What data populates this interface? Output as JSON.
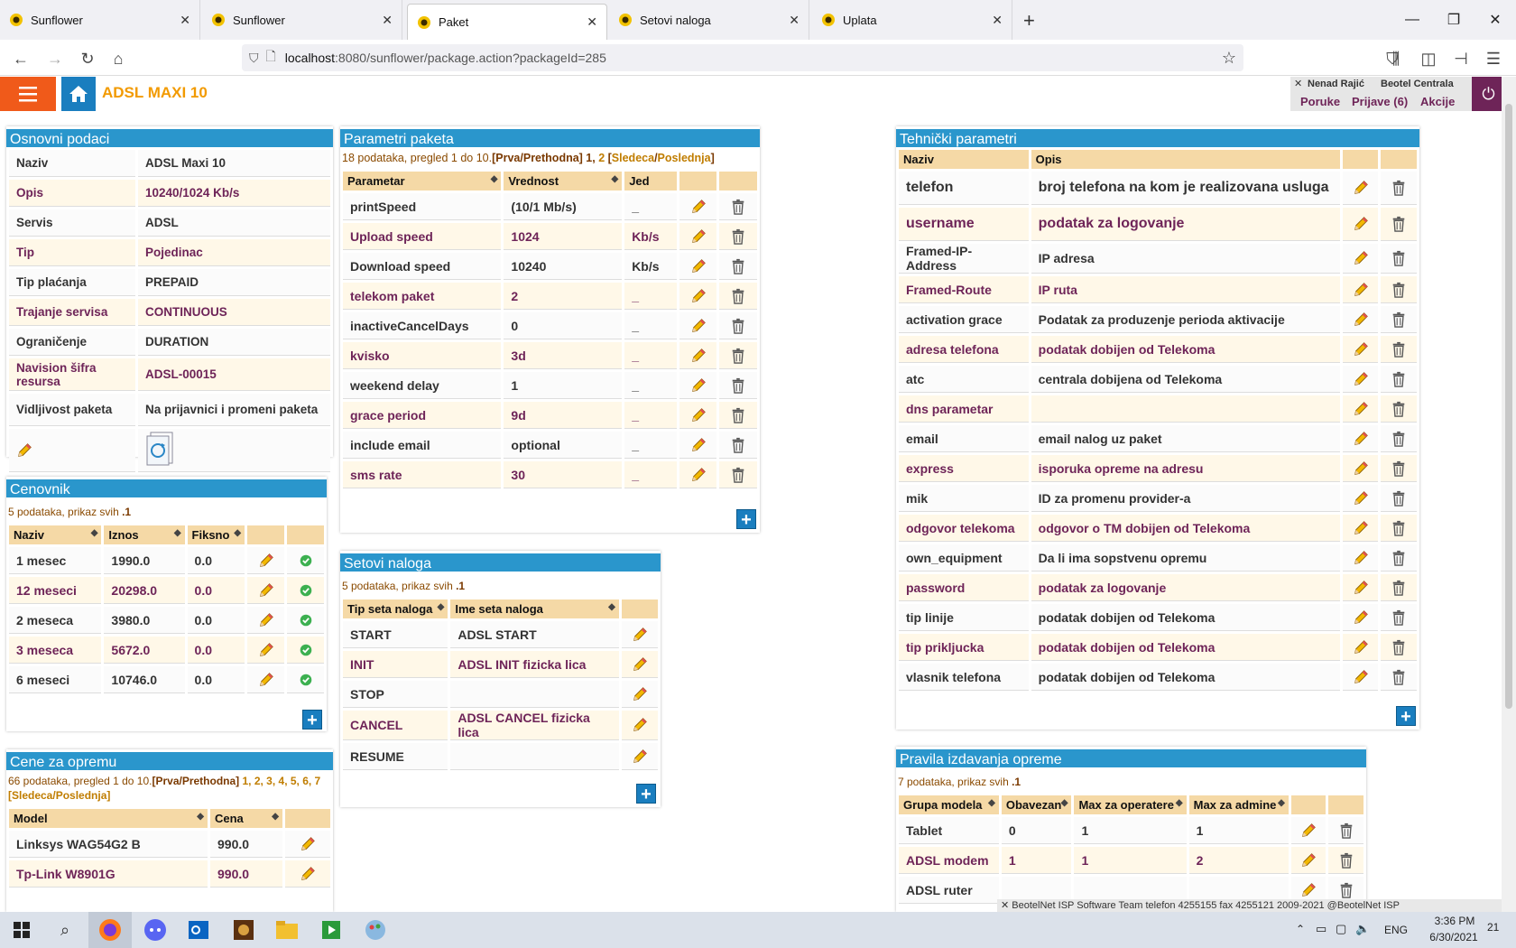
{
  "browser": {
    "tabs": [
      {
        "title": "Sunflower"
      },
      {
        "title": "Sunflower"
      },
      {
        "title": "Paket"
      },
      {
        "title": "Setovi naloga"
      },
      {
        "title": "Uplata"
      }
    ],
    "new_tab": "+",
    "url_host": "localhost",
    "url_rest": ":8080/sunflower/package.action?packageId=285"
  },
  "app": {
    "title": "ADSL MAXI 10",
    "user": "Nenad Rajić",
    "location": "Beotel Centrala",
    "nav": {
      "poruke": "Poruke",
      "prijave": "Prijave (6)",
      "akcije": "Akcije"
    },
    "close": "✕"
  },
  "osnovni": {
    "title": "Osnovni podaci",
    "rows": [
      {
        "label": "Naziv",
        "value": "ADSL Maxi 10"
      },
      {
        "label": "Opis",
        "value": "10240/1024 Kb/s"
      },
      {
        "label": "Servis",
        "value": "ADSL"
      },
      {
        "label": "Tip",
        "value": "Pojedinac"
      },
      {
        "label": "Tip plaćanja",
        "value": "PREPAID"
      },
      {
        "label": "Trajanje servisa",
        "value": "CONTINUOUS"
      },
      {
        "label": "Ograničenje",
        "value": "DURATION"
      },
      {
        "label": "Navision šifra resursa",
        "value": "ADSL-00015"
      },
      {
        "label": "Vidljivost paketa",
        "value": "Na prijavnici i promeni paketa"
      }
    ]
  },
  "parametri": {
    "title": "Parametri paketa",
    "pager_a": "18 podataka, pregled 1 do 10.",
    "pager_b": "[Prva/Prethodna]",
    "pager_c": " 1, ",
    "pager_d": "2",
    "pager_e": " [",
    "pager_f": "Sledeca",
    "pager_g": "/",
    "pager_h": "Poslednja",
    "pager_i": "]",
    "columns": [
      "Parametar",
      "Vrednost",
      "Jed"
    ],
    "rows": [
      {
        "p": "printSpeed",
        "v": "(10/1 Mb/s)",
        "u": "_"
      },
      {
        "p": "Upload speed",
        "v": "1024",
        "u": "Kb/s"
      },
      {
        "p": "Download speed",
        "v": "10240",
        "u": "Kb/s"
      },
      {
        "p": "telekom paket",
        "v": "2",
        "u": "_"
      },
      {
        "p": "inactiveCancelDays",
        "v": "0",
        "u": "_"
      },
      {
        "p": "kvisko",
        "v": "3d",
        "u": "_"
      },
      {
        "p": "weekend delay",
        "v": "1",
        "u": "_"
      },
      {
        "p": "grace period",
        "v": "9d",
        "u": "_"
      },
      {
        "p": "include email",
        "v": "optional",
        "u": "_"
      },
      {
        "p": "sms rate",
        "v": "30",
        "u": "_"
      }
    ]
  },
  "tehnicki": {
    "title": "Tehnički parametri",
    "columns": [
      "Naziv",
      "Opis"
    ],
    "rows": [
      {
        "n": "telefon",
        "o": "broj telefona na kom je realizovana usluga"
      },
      {
        "n": "username",
        "o": "podatak za logovanje"
      },
      {
        "n": "Framed-IP-Address",
        "o": "IP adresa"
      },
      {
        "n": "Framed-Route",
        "o": "IP ruta"
      },
      {
        "n": "activation grace",
        "o": "Podatak za produzenje perioda aktivacije"
      },
      {
        "n": "adresa telefona",
        "o": "podatak dobijen od Telekoma"
      },
      {
        "n": "atc",
        "o": "centrala dobijena od Telekoma"
      },
      {
        "n": "dns parametar",
        "o": ""
      },
      {
        "n": "email",
        "o": "email nalog uz paket"
      },
      {
        "n": "express",
        "o": "isporuka opreme na adresu"
      },
      {
        "n": "mik",
        "o": "ID za promenu provider-a"
      },
      {
        "n": "odgovor telekoma",
        "o": "odgovor o TM dobijen od Telekoma"
      },
      {
        "n": "own_equipment",
        "o": "Da li ima sopstvenu opremu"
      },
      {
        "n": "password",
        "o": "podatak za logovanje"
      },
      {
        "n": "tip linije",
        "o": "podatak dobijen od Telekoma"
      },
      {
        "n": "tip prikljucka",
        "o": "podatak dobijen od Telekoma"
      },
      {
        "n": "vlasnik telefona",
        "o": "podatak dobijen od Telekoma"
      }
    ]
  },
  "cenovnik": {
    "title": "Cenovnik",
    "pager_a": "5 podataka, prikaz svih ",
    "pager_b": ".1",
    "columns": [
      "Naziv",
      "Iznos",
      "Fiksno"
    ],
    "rows": [
      {
        "n": "1 mesec",
        "i": "1990.0",
        "f": "0.0"
      },
      {
        "n": "12 meseci",
        "i": "20298.0",
        "f": "0.0"
      },
      {
        "n": "2 meseca",
        "i": "3980.0",
        "f": "0.0"
      },
      {
        "n": "3 meseca",
        "i": "5672.0",
        "f": "0.0"
      },
      {
        "n": "6 meseci",
        "i": "10746.0",
        "f": "0.0"
      }
    ]
  },
  "setovi": {
    "title": "Setovi naloga",
    "pager_a": "5 podataka, prikaz svih ",
    "pager_b": ".1",
    "columns": [
      "Tip seta naloga",
      "Ime seta naloga"
    ],
    "rows": [
      {
        "t": "START",
        "i": "ADSL START"
      },
      {
        "t": "INIT",
        "i": "ADSL INIT fizicka lica"
      },
      {
        "t": "STOP",
        "i": ""
      },
      {
        "t": "CANCEL",
        "i": "ADSL CANCEL fizicka lica"
      },
      {
        "t": "RESUME",
        "i": ""
      }
    ]
  },
  "cene": {
    "title": "Cene za opremu",
    "pager_a": "66 podataka, pregled 1 do 10.",
    "pager_b": "[Prva/Prethodna]",
    "pages": " 1, 2, 3, 4, 5, 6, 7 ",
    "pager_c": "[Sledeca/Poslednja]",
    "columns": [
      "Model",
      "Cena"
    ],
    "rows": [
      {
        "m": "Linksys WAG54G2 B",
        "c": "990.0"
      },
      {
        "m": "Tp-Link W8901G",
        "c": "990.0"
      }
    ]
  },
  "pravila": {
    "title": "Pravila izdavanja opreme",
    "pager_a": "7 podataka, prikaz svih ",
    "pager_b": ".1",
    "columns": [
      "Grupa modela",
      "Obavezan",
      "Max za operatere",
      "Max za admine"
    ],
    "rows": [
      {
        "g": "Tablet",
        "o": "0",
        "mo": "1",
        "ma": "1"
      },
      {
        "g": "ADSL modem",
        "o": "1",
        "mo": "1",
        "ma": "2"
      },
      {
        "g": "ADSL ruter",
        "o": "",
        "mo": "",
        "ma": ""
      }
    ]
  },
  "footer": {
    "text": "BeotelNet ISP Software Team  telefon 4255155  fax 4255121  2009-2021 @BeotelNet ISP"
  },
  "taskbar": {
    "lang": "ENG",
    "time": "3:36 PM",
    "date": "6/30/2021",
    "notif": "21"
  }
}
